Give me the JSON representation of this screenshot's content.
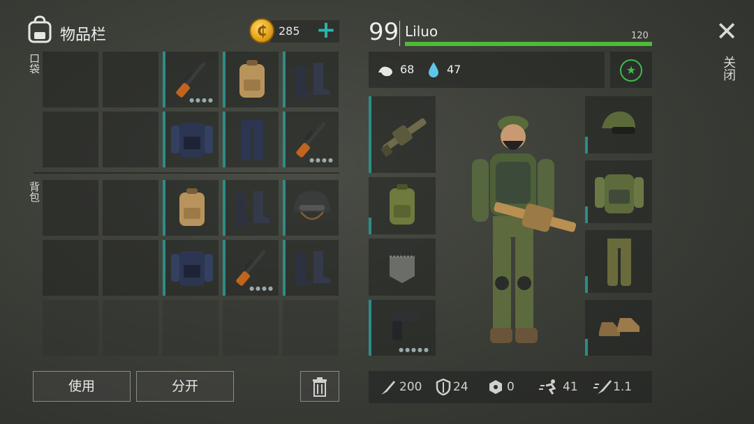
{
  "header": {
    "inventory_title": "物品栏",
    "coin_icon": "coin-icon",
    "coins": "285",
    "plus_label": "+"
  },
  "sections": {
    "pockets_label": "口袋",
    "backpack_label": "背包"
  },
  "inventory": {
    "pockets": [
      [
        {
          "item": ""
        },
        {
          "item": ""
        },
        {
          "item": "rifle",
          "dots": "●●●●"
        },
        {
          "item": "backpack"
        },
        {
          "item": "boots"
        }
      ],
      [
        {
          "item": ""
        },
        {
          "item": ""
        },
        {
          "item": "police-vest"
        },
        {
          "item": "pants"
        },
        {
          "item": "rifle",
          "dots": "●●●●"
        }
      ]
    ],
    "backpack": [
      [
        {
          "item": ""
        },
        {
          "item": ""
        },
        {
          "item": "backpack"
        },
        {
          "item": "boots"
        },
        {
          "item": "helmet"
        }
      ],
      [
        {
          "item": ""
        },
        {
          "item": ""
        },
        {
          "item": "police-vest"
        },
        {
          "item": "rifle",
          "dots": "●●●●"
        },
        {
          "item": "boots"
        }
      ],
      [
        {
          "item": ""
        },
        {
          "item": ""
        },
        {
          "item": ""
        },
        {
          "item": ""
        },
        {
          "item": ""
        }
      ]
    ]
  },
  "actions": {
    "use_label": "使用",
    "split_label": "分开",
    "trash_icon": "trash-icon"
  },
  "player": {
    "level": "99",
    "name": "Liluo",
    "hp_max": "120",
    "hp_fraction": 1.0,
    "hunger": "68",
    "thirst": "47"
  },
  "equipment": {
    "left_slots": [
      "grenade-launcher",
      "military-backpack",
      "pocket-empty",
      "pistol"
    ],
    "pistol_dots": "●●●●●",
    "right_slots": [
      "cap-with-goggles",
      "camo-jacket",
      "camo-pants",
      "shoes"
    ]
  },
  "stats": {
    "attack": "200",
    "defense": "24",
    "radiation": "0",
    "speed": "41",
    "attack_speed": "1.1"
  },
  "close": {
    "close_label": "关闭"
  },
  "colors": {
    "accent_teal": "#2c8d87",
    "hp_green": "#4dbb36",
    "coin_gold": "#e4a61b",
    "star_green": "#3ebc4a"
  }
}
